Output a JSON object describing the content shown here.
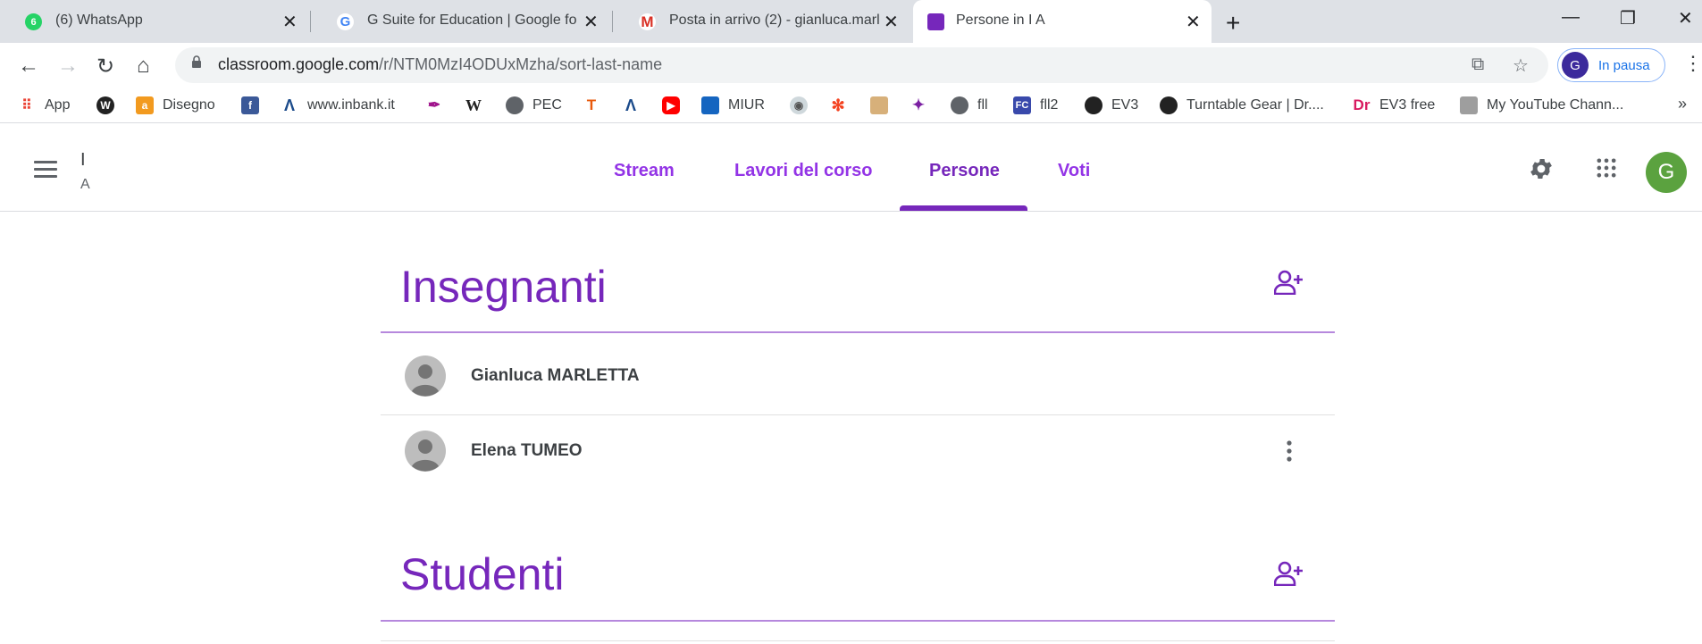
{
  "browser": {
    "tabs": [
      {
        "title": "(6) WhatsApp",
        "badge": "6"
      },
      {
        "title": "G Suite for Education | Google fo"
      },
      {
        "title": "Posta in arrivo (2) - gianluca.marl"
      },
      {
        "title": "Persone in I A"
      }
    ],
    "url_host": "classroom.google.com",
    "url_path": "/r/NTM0MzI4ODUxMzha/sort-last-name",
    "profile_initial": "G",
    "profile_status": "In pausa",
    "bookmarks": [
      "App",
      "Disegno",
      "www.inbank.it",
      "PEC",
      "MIUR",
      "fll",
      "fll2",
      "EV3",
      "Turntable Gear | Dr....",
      "EV3 free",
      "My YouTube Chann..."
    ]
  },
  "header": {
    "course_name": "I",
    "course_section": "A",
    "nav": [
      "Stream",
      "Lavori del corso",
      "Persone",
      "Voti"
    ],
    "active_nav": "Persone",
    "user_initial": "G"
  },
  "teachers": {
    "title": "Insegnanti",
    "people": [
      "Gianluca MARLETTA",
      "Elena TUMEO"
    ]
  },
  "students": {
    "title": "Studenti"
  },
  "colors": {
    "accent": "#7627bb",
    "accent_light": "#9334e6",
    "avatar_green": "#5ba23f"
  }
}
